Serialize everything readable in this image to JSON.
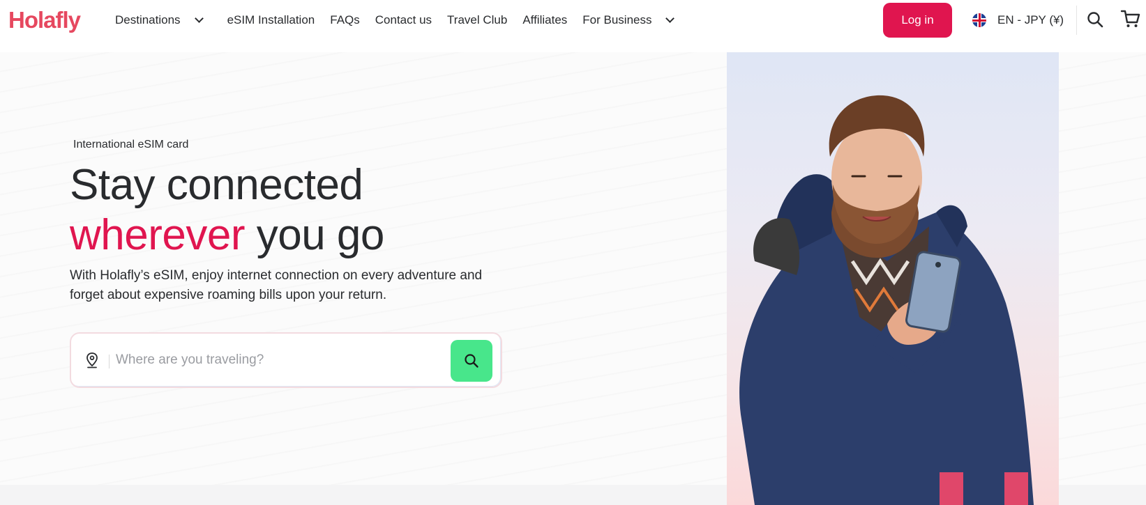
{
  "header": {
    "logo": "Holafly",
    "nav": [
      {
        "label": "Destinations",
        "has_dropdown": true
      },
      {
        "label": "eSIM Installation",
        "has_dropdown": false
      },
      {
        "label": "FAQs",
        "has_dropdown": false
      },
      {
        "label": "Contact us",
        "has_dropdown": false
      },
      {
        "label": "Travel Club",
        "has_dropdown": false
      },
      {
        "label": "Affiliates",
        "has_dropdown": false
      },
      {
        "label": "For Business",
        "has_dropdown": true
      }
    ],
    "login_label": "Log in",
    "language_label": "EN - JPY (¥)",
    "icons": [
      "uk-flag-icon",
      "search-icon",
      "cart-icon"
    ]
  },
  "hero": {
    "eyebrow": "International eSIM card",
    "title_line1": "Stay connected",
    "title_accent": "wherever",
    "title_rest": " you go",
    "subtitle": "With Holafly’s eSIM, enjoy internet connection on every adventure and forget about expensive roaming bills upon your return.",
    "search": {
      "placeholder": "Where are you traveling?",
      "value": ""
    }
  },
  "colors": {
    "brand": "#e0154f",
    "logo": "#e6485f",
    "search_button": "#48e68b",
    "text": "#292b2e"
  }
}
